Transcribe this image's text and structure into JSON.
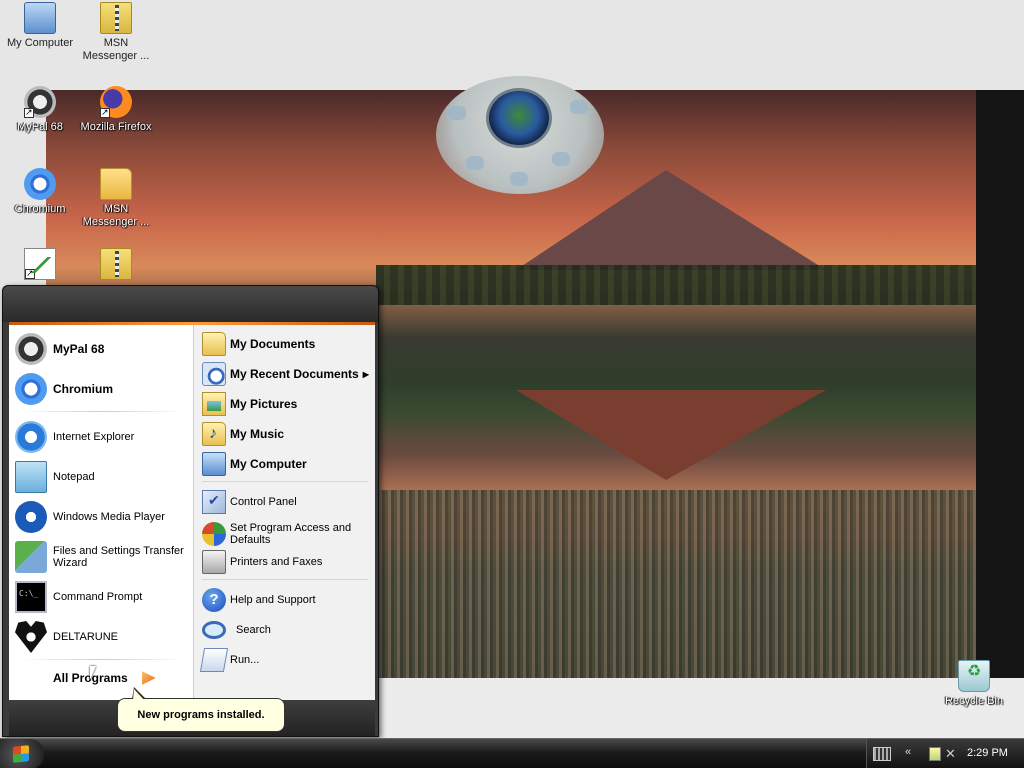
{
  "desktop": {
    "icons": [
      {
        "label": "My Computer",
        "icon": "my-computer-icon"
      },
      {
        "label": "MSN Messenger ...",
        "icon": "zip-folder-icon"
      },
      {
        "label": "MyPal 68",
        "icon": "mypal-icon"
      },
      {
        "label": "Mozilla Firefox",
        "icon": "firefox-icon"
      },
      {
        "label": "Chromium",
        "icon": "chromium-icon"
      },
      {
        "label": "MSN Messenger ...",
        "icon": "folder-icon"
      },
      {
        "label": "",
        "icon": "chart-document-icon"
      },
      {
        "label": "",
        "icon": "zip-folder-icon"
      },
      {
        "label": "Recycle Bin",
        "icon": "recycle-bin-icon"
      }
    ]
  },
  "start_menu": {
    "pinned": [
      {
        "label": "MyPal 68",
        "icon": "mypal-icon"
      },
      {
        "label": "Chromium",
        "icon": "chromium-icon"
      }
    ],
    "recent_programs": [
      {
        "label": "Internet Explorer",
        "icon": "internet-explorer-icon"
      },
      {
        "label": "Notepad",
        "icon": "notepad-icon"
      },
      {
        "label": "Windows Media Player",
        "icon": "media-player-icon"
      },
      {
        "label": "Files and Settings Transfer Wizard",
        "icon": "transfer-wizard-icon"
      },
      {
        "label": "Command Prompt",
        "icon": "command-prompt-icon"
      },
      {
        "label": "DELTARUNE",
        "icon": "deltarune-icon"
      }
    ],
    "all_programs_label": "All Programs",
    "places": [
      {
        "label": "My Documents",
        "icon": "my-documents-icon"
      },
      {
        "label": "My Recent Documents",
        "icon": "recent-documents-icon"
      },
      {
        "label": "My Pictures",
        "icon": "my-pictures-icon"
      },
      {
        "label": "My Music",
        "icon": "my-music-icon"
      },
      {
        "label": "My Computer",
        "icon": "my-computer-icon"
      }
    ],
    "system": [
      {
        "label": "Control Panel",
        "icon": "control-panel-icon"
      },
      {
        "label": "Set Program Access and Defaults",
        "icon": "program-access-icon"
      },
      {
        "label": "Printers and Faxes",
        "icon": "printer-icon"
      }
    ],
    "tools": [
      {
        "label": "Help and Support",
        "icon": "help-icon"
      },
      {
        "label": "Search",
        "icon": "search-icon"
      },
      {
        "label": "Run...",
        "icon": "run-icon"
      }
    ]
  },
  "balloon": {
    "text": "New programs installed."
  },
  "taskbar": {
    "clock": "2:29 PM",
    "tray_chevron": "«"
  }
}
